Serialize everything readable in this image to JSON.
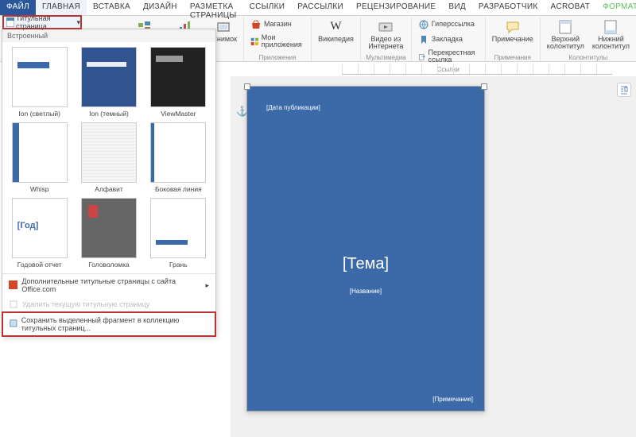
{
  "tabs": {
    "file": "ФАЙЛ",
    "home": "ГЛАВНАЯ",
    "insert": "ВСТАВКА",
    "design": "ДИЗАЙН",
    "layout": "РАЗМЕТКА СТРАНИЦЫ",
    "refs": "ССЫЛКИ",
    "mail": "РАССЫЛКИ",
    "review": "РЕЦЕНЗИРОВАНИЕ",
    "view": "ВИД",
    "dev": "РАЗРАБОТЧИК",
    "acrobat": "ACROBAT",
    "format": "ФОРМАТ"
  },
  "ribbon": {
    "smartart": "SmartArt",
    "chart": "Диаграмма",
    "screenshot": "Снимок",
    "store": "Магазин",
    "myapps": "Мои приложения",
    "wikipedia": "Википедия",
    "videoWeb": "Видео из Интернета",
    "hyperlink": "Гиперссылка",
    "bookmark": "Закладка",
    "crossref": "Перекрестная ссылка",
    "comment": "Примечание",
    "headerTop": "Верхний колонтитул",
    "headerBot": "Нижний колонтитул",
    "grp_apps": "Приложения",
    "grp_media": "Мультимедиа",
    "grp_links": "Ссылки",
    "grp_comments": "Примечания",
    "grp_headers": "Колонтитулы"
  },
  "dropdown": {
    "button": "Титульная страница",
    "section": "Встроенный",
    "items": [
      {
        "label": "Ion (светлый)"
      },
      {
        "label": "Ion (темный)"
      },
      {
        "label": "ViewMaster"
      },
      {
        "label": "Whisp"
      },
      {
        "label": "Алфавит"
      },
      {
        "label": "Боковая линия"
      },
      {
        "label": "Годовой отчет"
      },
      {
        "label": "Головоломка"
      },
      {
        "label": "Грань"
      }
    ],
    "more": "Дополнительные титульные страницы с сайта Office.com",
    "remove": "Удалить текущую титульную страницу",
    "save": "Сохранить выделенный фрагмент в коллекцию титульных страниц..."
  },
  "page": {
    "pubdate": "[Дата публикации]",
    "theme": "[Тема]",
    "subtitle": "[Название]",
    "note": "[Примечание]"
  }
}
